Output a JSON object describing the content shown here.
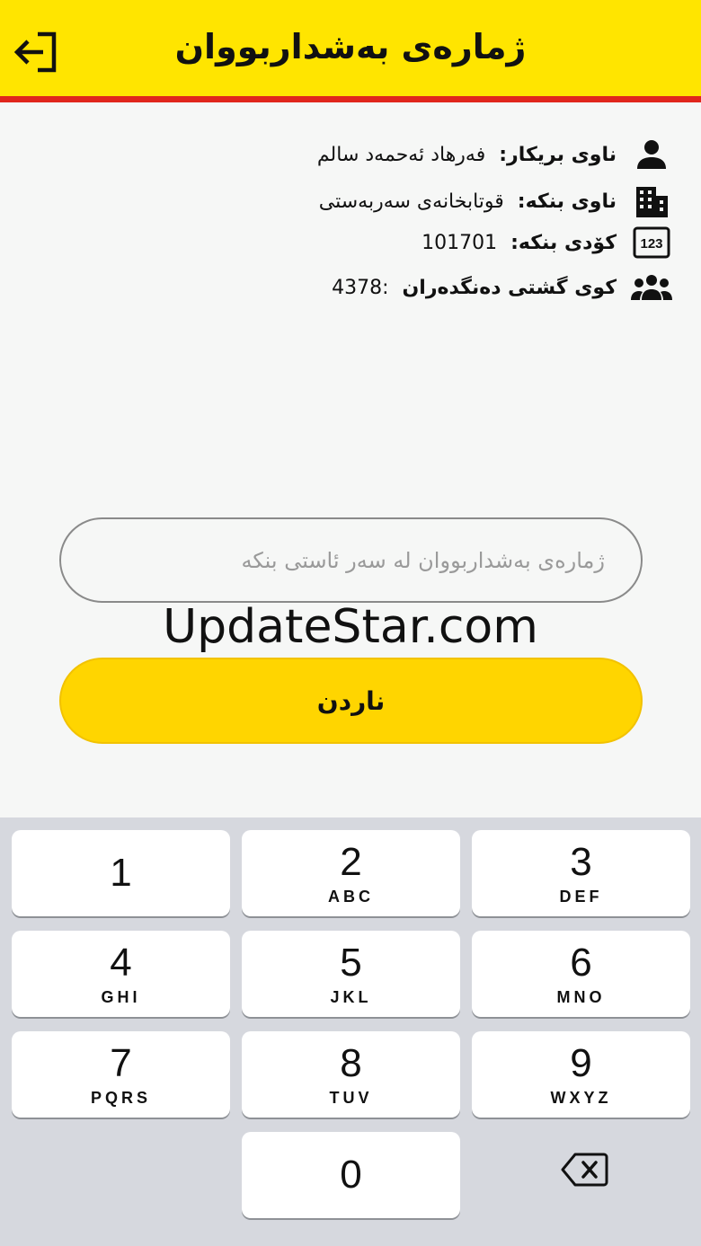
{
  "header": {
    "title": "ژمارەی بەشداربووان",
    "logout_icon": "logout-icon"
  },
  "info": [
    {
      "icon": "person-icon",
      "label": "ناوی بریکار:",
      "value": "فەرهاد ئەحمەد سالم"
    },
    {
      "icon": "building-icon",
      "label": "ناوی بنکە:",
      "value": "قوتابخانەی سەربەستی"
    },
    {
      "icon": "numbers-icon",
      "label": "کۆدی بنکە:",
      "value": "101701"
    },
    {
      "icon": "group-icon",
      "label": "کوی گشتی دەنگدەران",
      "value": ":4378"
    }
  ],
  "input": {
    "value": "",
    "placeholder": "ژمارەی بەشداربووان لە سەر ئاستی بنکە"
  },
  "watermark": "UpdateStar.com",
  "send_label": "ناردن",
  "keypad": {
    "keys": [
      {
        "num": "1",
        "letters": ""
      },
      {
        "num": "2",
        "letters": "ABC"
      },
      {
        "num": "3",
        "letters": "DEF"
      },
      {
        "num": "4",
        "letters": "GHI"
      },
      {
        "num": "5",
        "letters": "JKL"
      },
      {
        "num": "6",
        "letters": "MNO"
      },
      {
        "num": "7",
        "letters": "PQRS"
      },
      {
        "num": "8",
        "letters": "TUV"
      },
      {
        "num": "9",
        "letters": "WXYZ"
      },
      {
        "num": "0",
        "letters": ""
      }
    ],
    "backspace_icon": "backspace-icon"
  }
}
